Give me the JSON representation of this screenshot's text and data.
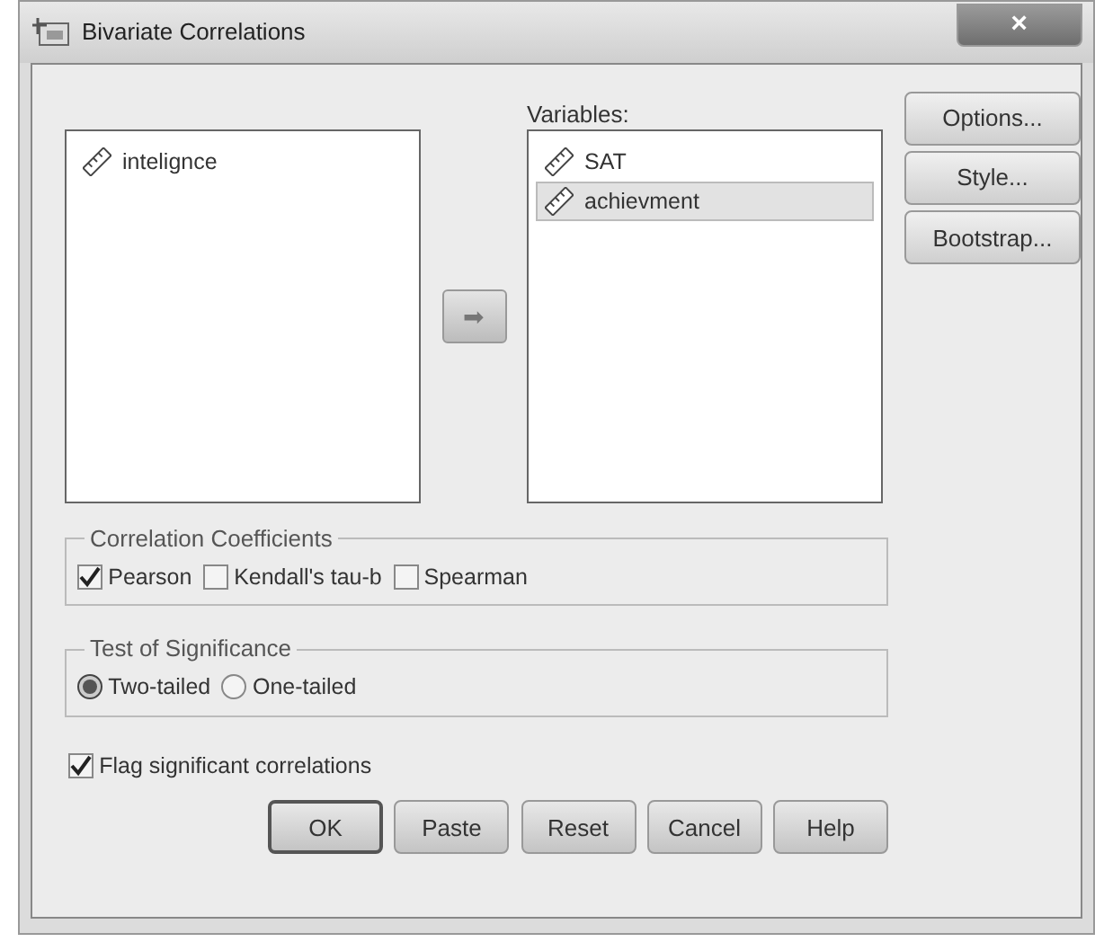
{
  "window": {
    "title": "Bivariate Correlations",
    "close": "×"
  },
  "source_list": {
    "items": [
      {
        "label": "intelignce",
        "selected": false
      }
    ]
  },
  "move_button": {
    "glyph": "➡"
  },
  "variables": {
    "label": "Variables:",
    "items": [
      {
        "label": "SAT",
        "selected": false
      },
      {
        "label": "achievment",
        "selected": true
      }
    ]
  },
  "side_buttons": [
    "Options...",
    "Style...",
    "Bootstrap..."
  ],
  "correlation_coefficients": {
    "legend": "Correlation Coefficients",
    "options": [
      {
        "label": "Pearson",
        "checked": true
      },
      {
        "label": "Kendall's tau-b",
        "checked": false
      },
      {
        "label": "Spearman",
        "checked": false
      }
    ]
  },
  "test_of_significance": {
    "legend": "Test of Significance",
    "options": [
      {
        "label": "Two-tailed",
        "selected": true
      },
      {
        "label": "One-tailed",
        "selected": false
      }
    ]
  },
  "flag": {
    "label": "Flag significant correlations",
    "checked": true
  },
  "buttons": [
    {
      "label": "OK",
      "default": true
    },
    {
      "label": "Paste",
      "default": false
    },
    {
      "label": "Reset",
      "default": false
    },
    {
      "label": "Cancel",
      "default": false
    },
    {
      "label": "Help",
      "default": false
    }
  ]
}
